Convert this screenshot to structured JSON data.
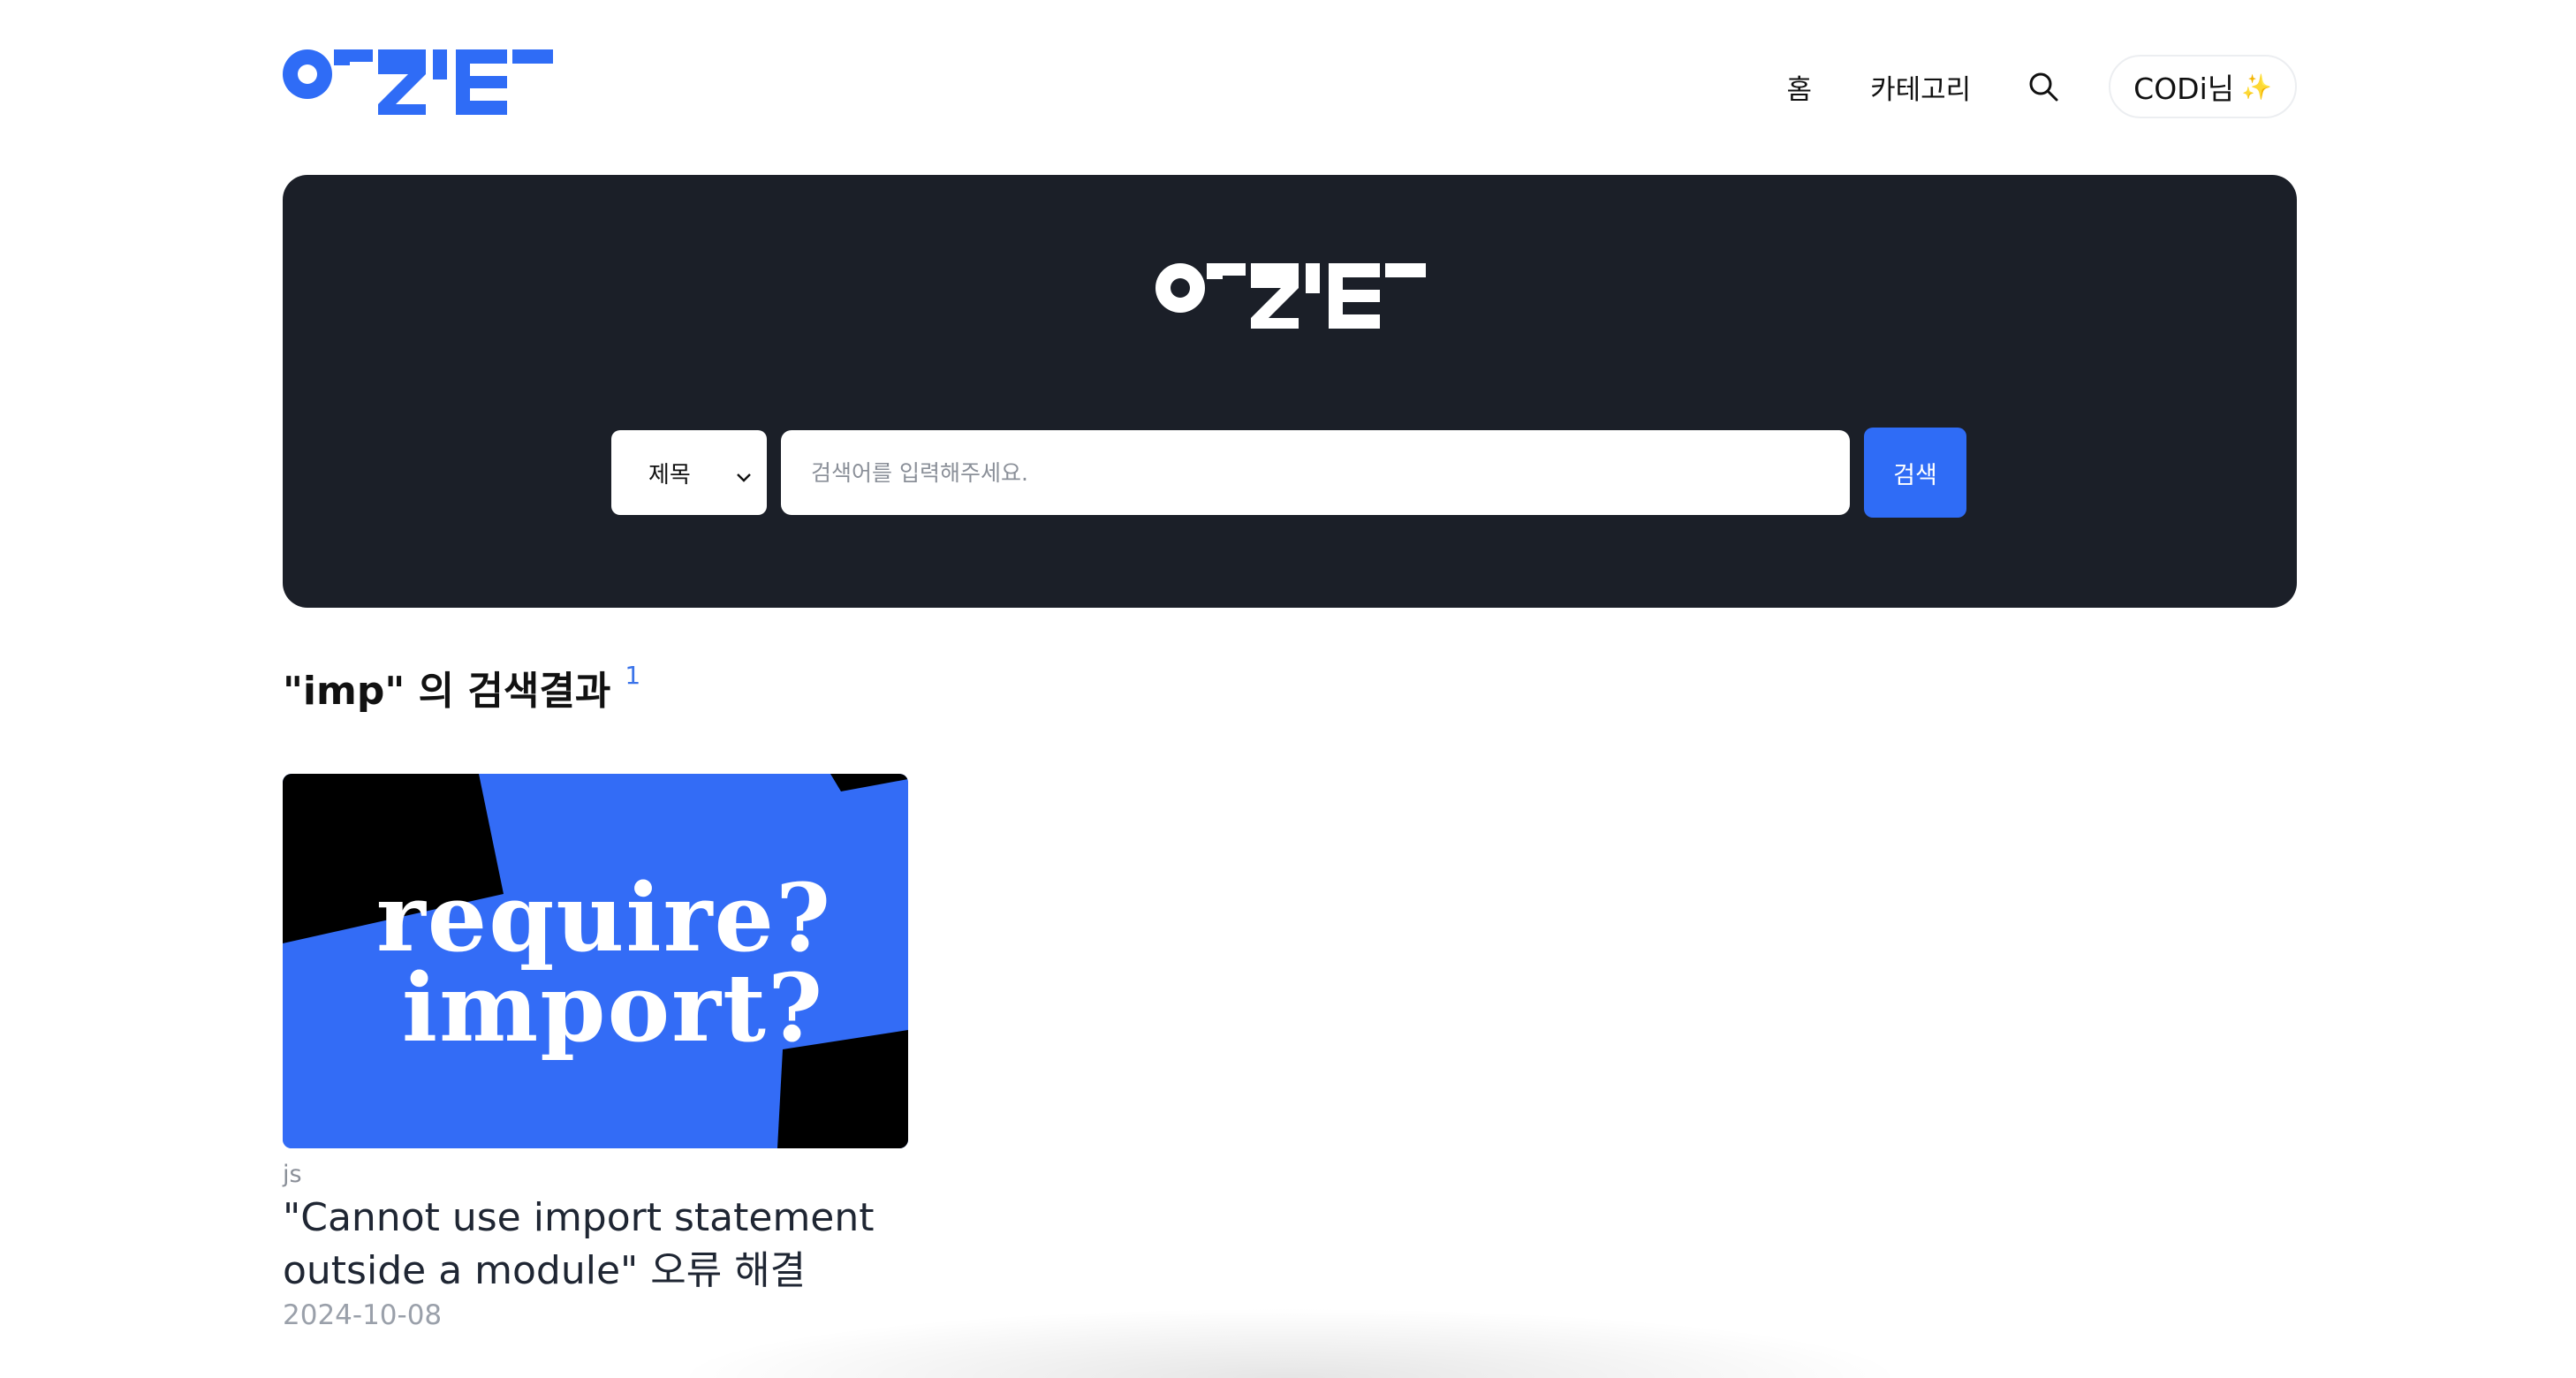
{
  "brand": {
    "logo_text": "ORZ'E",
    "accent": "#2f6cf6"
  },
  "header": {
    "nav": [
      {
        "label": "홈"
      },
      {
        "label": "카테고리"
      }
    ],
    "search_icon": "search-icon",
    "user_label": "CODi님",
    "user_sparkle": "✨"
  },
  "hero": {
    "background": "#1b1f28",
    "select": {
      "selected": "제목"
    },
    "input": {
      "placeholder": "검색어를 입력해주세요.",
      "value": ""
    },
    "button_label": "검색"
  },
  "results": {
    "title": "\"imp\" 의 검색결과",
    "count": "1",
    "items": [
      {
        "thumbnail_lines": [
          "require?",
          "import?"
        ],
        "category": "js",
        "title": "\"Cannot use import statement outside a module\" 오류 해결",
        "date": "2024-10-08"
      }
    ]
  }
}
